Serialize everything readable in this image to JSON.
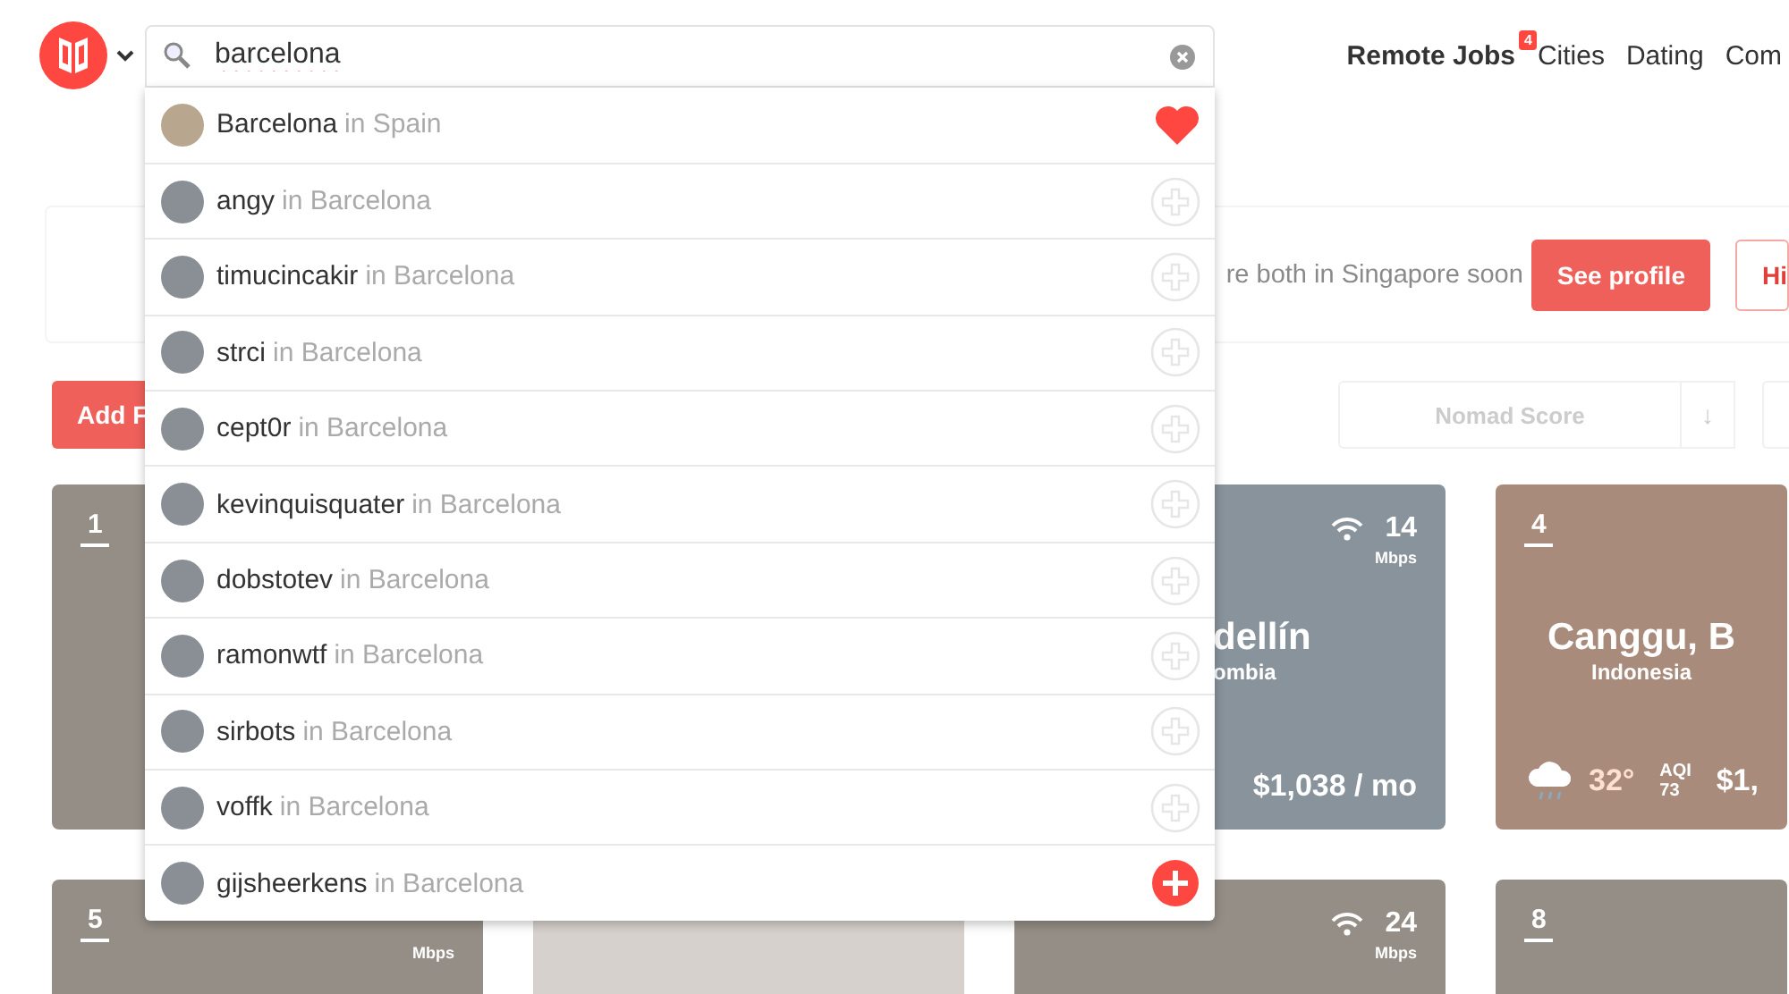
{
  "header": {
    "nav": [
      {
        "label": "Remote Jobs",
        "highlighted": true,
        "badge": "4"
      },
      {
        "label": "Cities",
        "highlighted": false
      },
      {
        "label": "Dating",
        "highlighted": false
      },
      {
        "label": "Com",
        "highlighted": false
      }
    ]
  },
  "search": {
    "value": "barcelona"
  },
  "results": [
    {
      "kind": "city",
      "name": "Barcelona",
      "location": "in Spain",
      "favorited": true
    },
    {
      "kind": "user",
      "name": "angy",
      "location": "in Barcelona",
      "selected": false
    },
    {
      "kind": "user",
      "name": "timucincakir",
      "location": "in Barcelona",
      "selected": false
    },
    {
      "kind": "user",
      "name": "strci",
      "location": "in Barcelona",
      "selected": false
    },
    {
      "kind": "user",
      "name": "cept0r",
      "location": "in Barcelona",
      "selected": false
    },
    {
      "kind": "user",
      "name": "kevinquisquater",
      "location": "in Barcelona",
      "selected": false
    },
    {
      "kind": "user",
      "name": "dobstotev",
      "location": "in Barcelona",
      "selected": false
    },
    {
      "kind": "user",
      "name": "ramonwtf",
      "location": "in Barcelona",
      "selected": false
    },
    {
      "kind": "user",
      "name": "sirbots",
      "location": "in Barcelona",
      "selected": false
    },
    {
      "kind": "user",
      "name": "voffk",
      "location": "in Barcelona",
      "selected": false
    },
    {
      "kind": "user",
      "name": "gijsheerkens",
      "location": "in Barcelona",
      "selected": true
    }
  ],
  "background": {
    "banner": {
      "text": "re both in Singapore soon",
      "buttons": [
        "See profile",
        "Hi"
      ]
    },
    "toolbar": {
      "add_button": "Add F",
      "sort": "Nomad Score",
      "sort_direction": "↓"
    },
    "cards": [
      {
        "rank": "1"
      },
      {
        "speed": "14",
        "speed_unit": "Mbps",
        "city": "dellín",
        "country": "ombia",
        "cost": "$1,038 / mo"
      },
      {
        "rank": "4",
        "city": "Canggu, B",
        "country": "Indonesia",
        "temperature": "32°",
        "aqi_label": "AQI",
        "aqi": "73",
        "cost": "$1,"
      },
      {
        "rank": "5",
        "speed_unit": "Mbps"
      },
      {
        "speed": "24",
        "speed_unit": "Mbps"
      },
      {
        "rank": "8"
      }
    ]
  }
}
